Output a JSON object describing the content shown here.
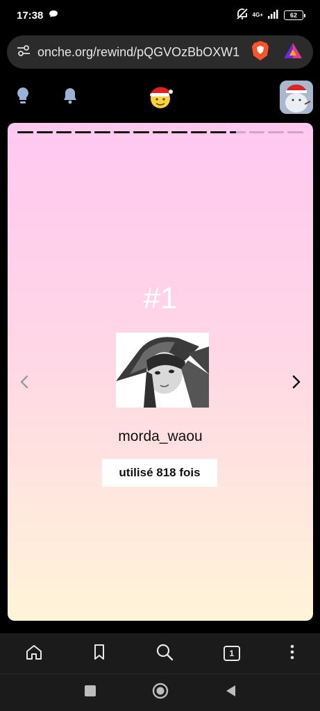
{
  "status_bar": {
    "time": "17:38",
    "network": "4G+",
    "battery": "62"
  },
  "browser": {
    "url": "onche.org/rewind/pQGVOzBbOXW1",
    "tab_count": "1"
  },
  "header": {
    "icons": [
      "lightbulb-icon",
      "bell-icon",
      "santa-smiley-logo",
      "user-avatar"
    ]
  },
  "story": {
    "total_segments": 15,
    "current_segment": 12,
    "rank": "#1",
    "sticker_name": "morda_waou",
    "usage": "utilisé 818 fois"
  },
  "colors": {
    "card_top": "#ffc8f0",
    "card_bottom": "#fff4d8",
    "toolbar_bg": "#1b1b1b",
    "accent_brave": "#fb542b"
  }
}
